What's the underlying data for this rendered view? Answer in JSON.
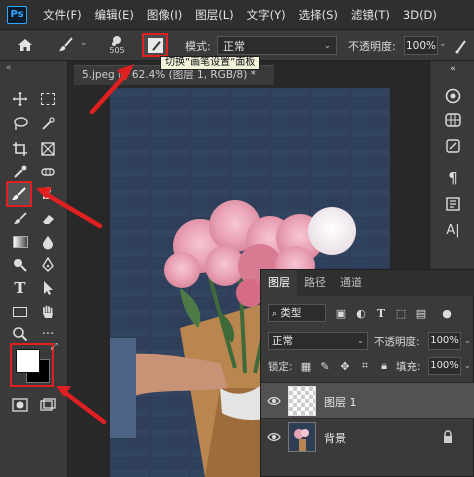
{
  "menubar": {
    "logo_text": "Ps",
    "items": [
      {
        "label": "文件(F)"
      },
      {
        "label": "编辑(E)"
      },
      {
        "label": "图像(I)"
      },
      {
        "label": "图层(L)"
      },
      {
        "label": "文字(Y)"
      },
      {
        "label": "选择(S)"
      },
      {
        "label": "滤镜(T)"
      },
      {
        "label": "3D(D)"
      }
    ]
  },
  "options": {
    "brush_size": "505",
    "mode_label": "模式:",
    "mode_value": "正常",
    "opacity_label": "不透明度:",
    "opacity_value": "100%"
  },
  "tooltip": {
    "text": "切换“画笔设置”面板"
  },
  "document": {
    "tab_title": "5.jpeg @ 62.4% (图层 1, RGB/8) *"
  },
  "layers_panel": {
    "tabs": [
      "图层",
      "路径",
      "通道"
    ],
    "active_tab": "图层",
    "filter_value": "类型",
    "blend_mode": "正常",
    "opacity_label": "不透明度:",
    "opacity_value": "100%",
    "lock_label": "锁定:",
    "fill_label": "填充:",
    "fill_value": "100%",
    "layers": [
      {
        "name": "图层 1",
        "selected": true,
        "locked": false
      },
      {
        "name": "背景",
        "selected": false,
        "locked": true
      }
    ]
  },
  "colors": {
    "foreground": "#ffffff",
    "background": "#000000",
    "annotation": "#e02020"
  }
}
